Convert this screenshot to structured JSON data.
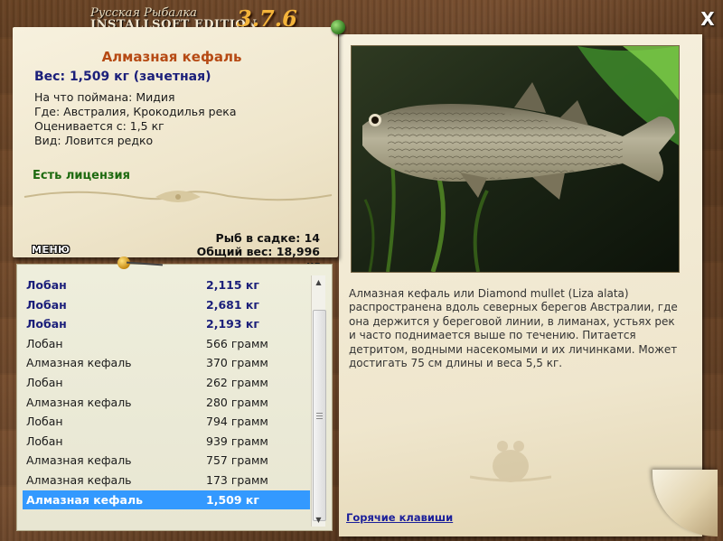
{
  "header": {
    "logo_line1": "Русская Рыбалка",
    "logo_line2": "INSTALLSOFT EDITION",
    "version": "3.7.6",
    "close_label": "X"
  },
  "fish": {
    "title": "Алмазная кефаль",
    "weight_line": "Вес: 1,509 кг (зачетная)",
    "caught_with": "На что поймана: Мидия",
    "location": "Где: Австралия, Крокодилья река",
    "valued_from": "Оценивается с: 1,5 кг",
    "kind": "Вид: Ловится редко",
    "license": "Есть лицензия"
  },
  "cage": {
    "count_line": "Рыб в садке: 14",
    "total_line": "Общий вес: 18,996 кг"
  },
  "menu_label": "МЕНЮ",
  "list": [
    {
      "name": "Лобан",
      "weight": "2,115 кг",
      "style": "bold"
    },
    {
      "name": "Лобан",
      "weight": "2,681 кг",
      "style": "bold"
    },
    {
      "name": "Лобан",
      "weight": "2,193 кг",
      "style": "bold"
    },
    {
      "name": "Лобан",
      "weight": "566 грамм",
      "style": "normal"
    },
    {
      "name": "Алмазная кефаль",
      "weight": "370 грамм",
      "style": "normal"
    },
    {
      "name": "Лобан",
      "weight": "262 грамм",
      "style": "normal"
    },
    {
      "name": "Алмазная кефаль",
      "weight": "280 грамм",
      "style": "normal"
    },
    {
      "name": "Лобан",
      "weight": "794 грамм",
      "style": "normal"
    },
    {
      "name": "Лобан",
      "weight": "939 грамм",
      "style": "normal"
    },
    {
      "name": "Алмазная кефаль",
      "weight": "757 грамм",
      "style": "normal"
    },
    {
      "name": "Алмазная кефаль",
      "weight": "173 грамм",
      "style": "normal"
    },
    {
      "name": "Алмазная кефаль",
      "weight": "1,509 кг",
      "style": "selected"
    }
  ],
  "description": "Алмазная кефаль или Diamond mullet (Liza alata) распространена вдоль северных берегов Австралии, где она держится у береговой линии, в лиманах, устьях рек и часто поднимается выше по течению. Питается детритом, водными насекомыми и их личинками. Может достигать 75 см длины и веса 5,5 кг.",
  "hotkeys_label": "Горячие клавиши",
  "colors": {
    "title": "#b64a14",
    "weight": "#1b1f7a",
    "license": "#1e6a10",
    "selection": "#3399ff",
    "link": "#1b1f9a"
  }
}
